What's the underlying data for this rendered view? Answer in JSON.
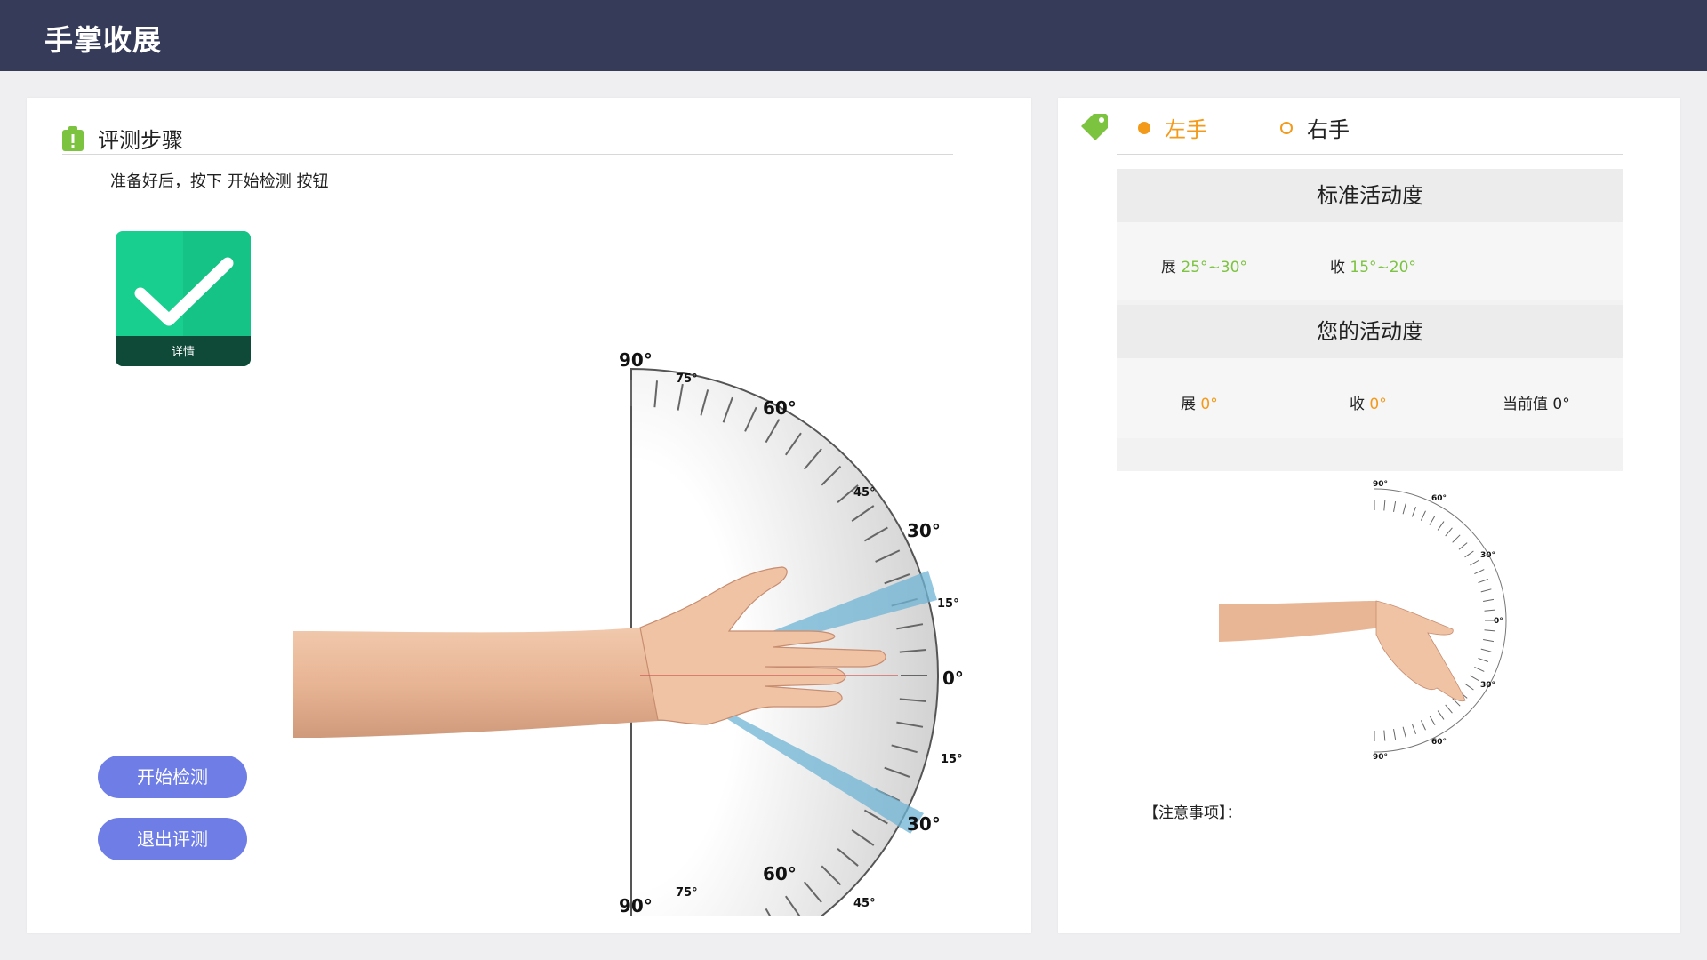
{
  "app": {
    "title": "手掌收展"
  },
  "left": {
    "section_title": "评测步骤",
    "instruction": "准备好后，按下 开始检测 按钮",
    "detail_label": "详情",
    "start_button": "开始检测",
    "exit_button": "退出评测",
    "gauge_labels": {
      "deg90": "90°",
      "deg75": "75°",
      "deg60": "60°",
      "deg45": "45°",
      "deg30": "30°",
      "deg15": "15°",
      "deg0": "0°"
    }
  },
  "right": {
    "tabs": [
      {
        "label": "左手",
        "selected": true
      },
      {
        "label": "右手",
        "selected": false
      }
    ],
    "standard": {
      "title": "标准活动度",
      "abduction_label": "展",
      "abduction_value": "25°~30°",
      "adduction_label": "收",
      "adduction_value": "15°~20°"
    },
    "yours": {
      "title": "您的活动度",
      "abduction_label": "展",
      "abduction_value": "0°",
      "adduction_label": "收",
      "adduction_value": "0°",
      "current_label": "当前值",
      "current_value": "0°"
    },
    "note_label": "【注意事项】："
  },
  "colors": {
    "header_bg": "#373b5a",
    "accent_orange": "#f39a1a",
    "accent_green": "#7cc340",
    "button_bg": "#6f7ee6",
    "detail_green": "#18cf8f",
    "sector_blue": "#7cb8d6"
  },
  "icons": {
    "clipboard": "clipboard-alert-icon",
    "tag": "tag-icon",
    "check": "check-icon"
  }
}
